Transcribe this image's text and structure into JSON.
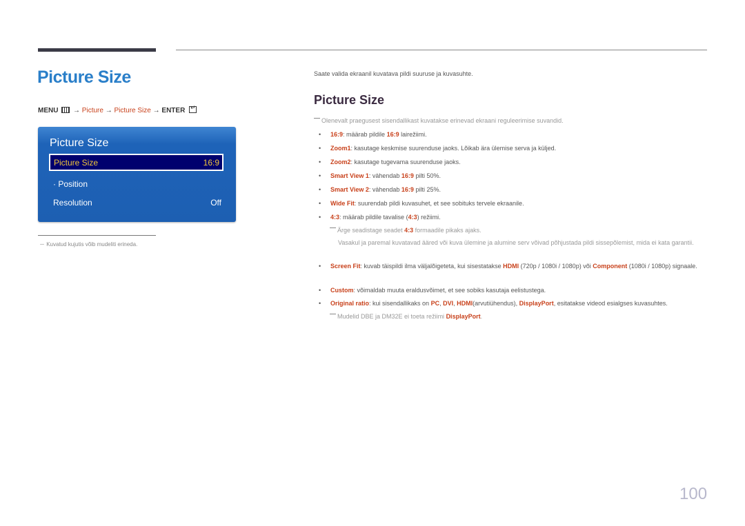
{
  "page_title": "Picture Size",
  "menu_path": {
    "menu": "MENU",
    "arrow": "→",
    "picture": "Picture",
    "picture_size": "Picture Size",
    "enter": "ENTER"
  },
  "osd": {
    "title": "Picture Size",
    "items": [
      {
        "label": "Picture Size",
        "value": "16:9",
        "selected": true
      },
      {
        "label": "· Position",
        "value": ""
      },
      {
        "label": "Resolution",
        "value": "Off"
      }
    ]
  },
  "footnote": "－ Kuvatud kujutis võib mudeliti erineda.",
  "intro": "Saate valida ekraanil kuvatava pildi suuruse ja kuvasuhte.",
  "section_title": "Picture Size",
  "note_top": "Olenevalt praegusest sisendallikast kuvatakse erinevad ekraani reguleerimise suvandid.",
  "bullets": {
    "b1": {
      "k": "16:9",
      "t1": ": määrab pildile ",
      "k2": "16:9",
      "t2": " lairežiimi."
    },
    "b2": {
      "k": "Zoom1",
      "t1": ": kasutage keskmise suurenduse jaoks. Lõikab ära ülemise serva ja küljed."
    },
    "b3": {
      "k": "Zoom2",
      "t1": ": kasutage tugevama suurenduse jaoks."
    },
    "b4": {
      "k": "Smart View 1",
      "t1": ": vähendab ",
      "k2": "16:9",
      "t2": " pilti 50%."
    },
    "b5": {
      "k": "Smart View 2",
      "t1": ": vähendab ",
      "k2": "16:9",
      "t2": " pilti 25%."
    },
    "b6": {
      "k": "Wide Fit",
      "t1": ": suurendab pildi kuvasuhet, et see sobituks tervele ekraanile."
    },
    "b7": {
      "k": "4:3",
      "t1": ": määrab pildile tavalise (",
      "k2": "4:3",
      "t2": ") režiimi."
    },
    "b8": {
      "k": "Screen Fit",
      "t1": ": kuvab täispildi ilma väljalõigeteta, kui sisestatakse ",
      "k2": "HDMI",
      "t2": " (720p / 1080i / 1080p) või ",
      "k3": "Component",
      "t3": " (1080i / 1080p) signaale."
    },
    "b9": {
      "k": "Custom",
      "t1": ": võimaldab muuta eraldusvõimet, et see sobiks kasutaja eelistustega."
    },
    "b10": {
      "k": "Original ratio",
      "t1": ": kui sisendallikaks on ",
      "k2": "PC",
      "t2": ", ",
      "k3": "DVI",
      "t3": ", ",
      "k4": "HDMI",
      "t4": "(arvutiühendus), ",
      "k5": "DisplayPort",
      "t5": ", esitatakse videod esialgses kuvasuhtes."
    }
  },
  "note_43": {
    "t1": "Ärge seadistage seadet ",
    "k": "4:3",
    "t2": " formaadile pikaks ajaks."
  },
  "note_43_b": "Vasakul ja paremal kuvatavad ääred või kuva ülemine ja alumine serv võivad põhjustada pildi sissepõlemist, mida ei kata garantii.",
  "note_dp": {
    "t1": "Mudelid DBE ja DM32E ei toeta režiimi ",
    "k": "DisplayPort",
    "t2": "."
  },
  "bullet_char": "•",
  "page_number": "100"
}
